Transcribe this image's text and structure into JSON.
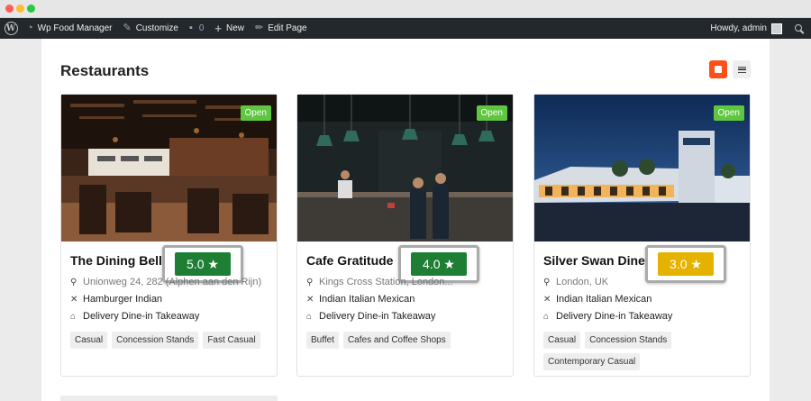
{
  "admin_bar": {
    "site_name": "Wp Food Manager",
    "customize": "Customize",
    "comments_count": "0",
    "new_label": "New",
    "edit_page": "Edit Page",
    "howdy": "Howdy, admin"
  },
  "page": {
    "title": "Restaurants",
    "accent_color": "#ff4f18"
  },
  "restaurants": [
    {
      "name": "The Dining Bell",
      "status": "Open",
      "rating": "5.0 ★",
      "rating_color": "#1e7e34",
      "address": "Unionweg 24, 282 (Alphen aan den Rijn)",
      "cuisine": "Hamburger Indian",
      "services": "Delivery Dine-in Takeaway",
      "tags": [
        "Casual",
        "Concession Stands",
        "Fast Casual"
      ]
    },
    {
      "name": "Cafe Gratitude",
      "status": "Open",
      "rating": "4.0 ★",
      "rating_color": "#1e7e34",
      "address": "Kings Cross Station, London...",
      "cuisine": "Indian Italian Mexican",
      "services": "Delivery Dine-in Takeaway",
      "tags": [
        "Buffet",
        "Cafes and Coffee Shops"
      ]
    },
    {
      "name": "Silver Swan Diner",
      "status": "Open",
      "rating": "3.0 ★",
      "rating_color": "#e5b200",
      "address": "London, UK",
      "cuisine": "Indian Italian Mexican",
      "services": "Delivery Dine-in Takeaway",
      "tags": [
        "Casual",
        "Concession Stands",
        "Contemporary Casual"
      ]
    }
  ]
}
